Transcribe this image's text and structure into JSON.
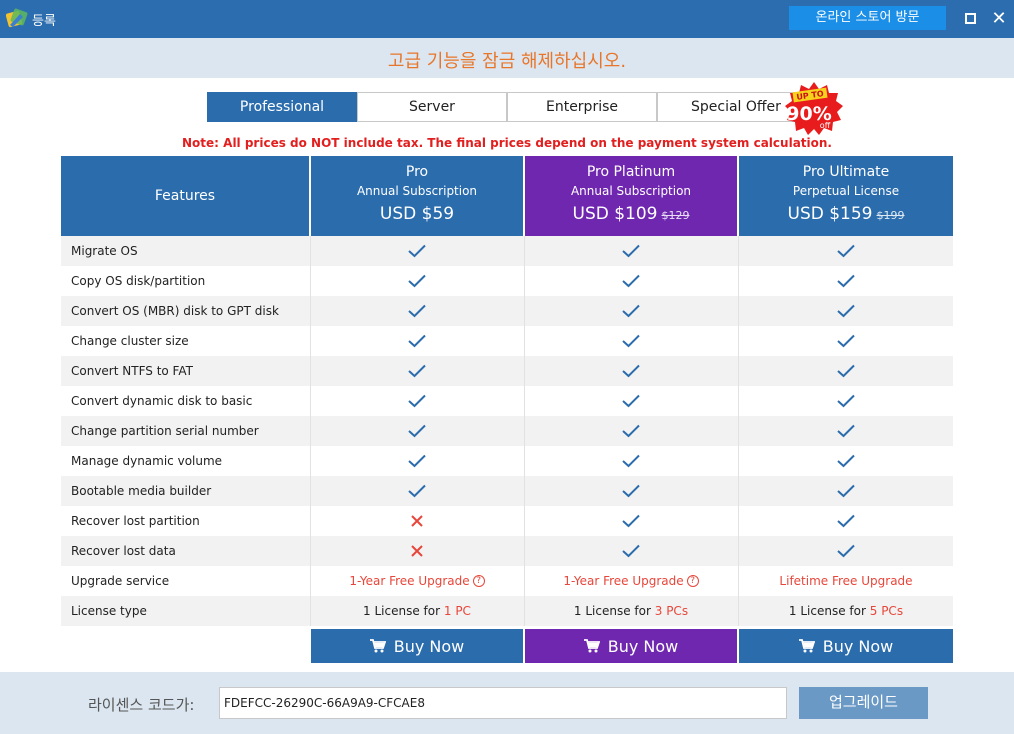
{
  "window": {
    "title": "등록",
    "store_button": "온라인 스토어 방문",
    "close_glyph": "✕"
  },
  "header": {
    "text": "고급 기능을 잠금 해제하십시오."
  },
  "tabs": [
    {
      "label": "Professional"
    },
    {
      "label": "Server"
    },
    {
      "label": "Enterprise"
    },
    {
      "label": "Special Offer"
    }
  ],
  "badge": {
    "top": "UP TO",
    "value": "90%",
    "bottom": "off"
  },
  "note": "Note: All prices do NOT include tax. The final prices depend on the payment system calculation.",
  "table": {
    "features_header": "Features",
    "plans": [
      {
        "name": "Pro",
        "sub": "Annual Subscription",
        "price": "USD $59",
        "old_price": "",
        "color": "#2b6cad"
      },
      {
        "name": "Pro Platinum",
        "sub": "Annual Subscription",
        "price": "USD $109",
        "old_price": "$129",
        "color": "#7027b0"
      },
      {
        "name": "Pro Ultimate",
        "sub": "Perpetual License",
        "price": "USD $159",
        "old_price": "$199",
        "color": "#2b6cad"
      }
    ],
    "features": [
      {
        "label": "Migrate OS",
        "values": [
          "check",
          "check",
          "check"
        ]
      },
      {
        "label": "Copy OS disk/partition",
        "values": [
          "check",
          "check",
          "check"
        ]
      },
      {
        "label": "Convert OS (MBR) disk to GPT disk",
        "values": [
          "check",
          "check",
          "check"
        ]
      },
      {
        "label": "Change cluster size",
        "values": [
          "check",
          "check",
          "check"
        ]
      },
      {
        "label": "Convert NTFS to FAT",
        "values": [
          "check",
          "check",
          "check"
        ]
      },
      {
        "label": "Convert dynamic disk to basic",
        "values": [
          "check",
          "check",
          "check"
        ]
      },
      {
        "label": "Change partition serial number",
        "values": [
          "check",
          "check",
          "check"
        ]
      },
      {
        "label": "Manage dynamic volume",
        "values": [
          "check",
          "check",
          "check"
        ]
      },
      {
        "label": "Bootable media builder",
        "values": [
          "check",
          "check",
          "check"
        ]
      },
      {
        "label": "Recover lost partition",
        "values": [
          "cross",
          "check",
          "check"
        ]
      },
      {
        "label": "Recover lost data",
        "values": [
          "cross",
          "check",
          "check"
        ]
      }
    ],
    "upgrade_row": {
      "label": "Upgrade service",
      "values": [
        "1-Year Free Upgrade",
        "1-Year Free Upgrade",
        "Lifetime Free Upgrade"
      ],
      "help": "?"
    },
    "license_row": {
      "label": "License type",
      "prefix": "1 License for ",
      "counts": [
        "1 PC",
        "3 PCs",
        "5 PCs"
      ]
    },
    "buy_label": "Buy Now"
  },
  "footer": {
    "label": "라이센스 코드가:",
    "code": "FDEFCC-26290C-66A9A9-CFCAE8",
    "upgrade_button": "업그레이드"
  },
  "colors": {
    "accent": "#2b6cad",
    "platinum": "#7027b0",
    "check": "#2b6cad",
    "cross": "#e8463a",
    "header_text": "#e8762a"
  }
}
